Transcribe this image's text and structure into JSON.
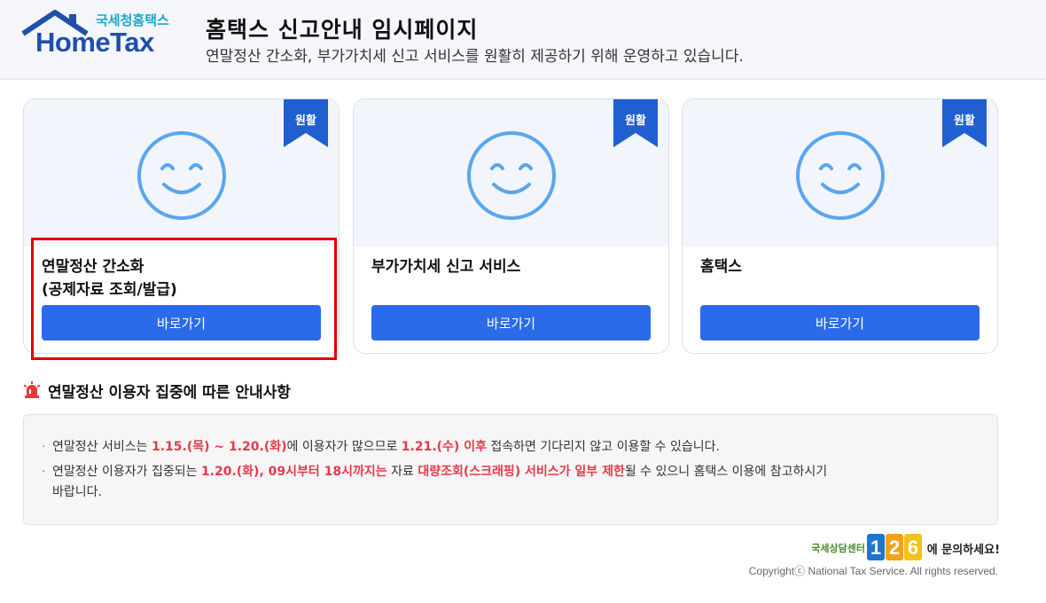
{
  "header": {
    "logo_sub": "국세청홈택스",
    "logo_main": "HomeTax",
    "title": "홈택스 신고안내 임시페이지",
    "subtitle": "연말정산 간소화, 부가가치세 신고 서비스를 원활히 제공하기 위해 운영하고 있습니다."
  },
  "cards": [
    {
      "badge": "원활",
      "title_line1": "연말정산 간소화",
      "title_line2": "(공제자료 조회/발급)",
      "button": "바로가기"
    },
    {
      "badge": "원활",
      "title_line1": "부가가치세 신고 서비스",
      "title_line2": "",
      "button": "바로가기"
    },
    {
      "badge": "원활",
      "title_line1": "홈택스",
      "title_line2": "",
      "button": "바로가기"
    }
  ],
  "notice": {
    "title": "연말정산 이용자 집중에 따른 안내사항",
    "item1": {
      "p1": "연말정산 서비스는 ",
      "h1": "1.15.(목) ~ 1.20.(화)",
      "p2": "에 이용자가 많으므로 ",
      "h2": "1.21.(수) 이후",
      "p3": " 접속하면 기다리지 않고 이용할 수 있습니다."
    },
    "item2": {
      "p1": "연말정산 이용자가 집중되는 ",
      "h1": "1.20.(화), 09시부터 18시까지는",
      "p2": " 자료 ",
      "h2": "대량조회(스크래핑) 서비스가 일부 제한",
      "p3": "될 수 있으니 홈택스 이용에 참고하시기",
      "p4": "바랍니다."
    }
  },
  "footer": {
    "help_brand": "국세상담센터",
    "help_number": "126",
    "help_text": "에 문의하세요!",
    "copyright": "Copyrightⓒ National Tax Service. All rights reserved."
  },
  "colors": {
    "primary_button": "#2b6ae8",
    "badge": "#1f5fd0",
    "highlight_border": "#e00000",
    "notice_highlight": "#e5394b",
    "smiley": "#5aa6ee"
  }
}
